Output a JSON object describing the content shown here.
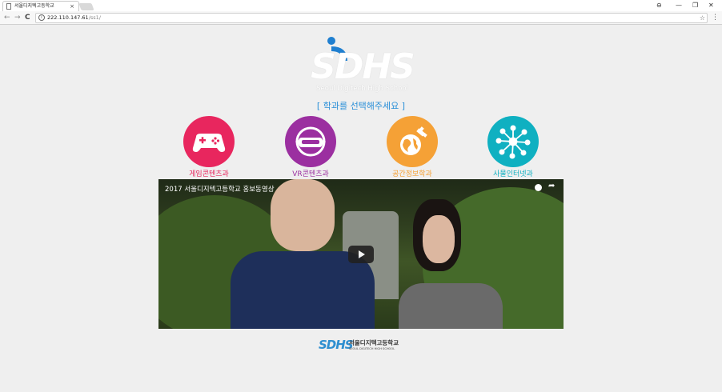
{
  "browser": {
    "tab_title": "서울디지텍고등학교",
    "tab_close": "×",
    "url_host": "222.110.147.61",
    "url_path": "/ss1/",
    "back": "←",
    "forward": "→",
    "reload": "C",
    "info": "i",
    "star": "☆",
    "menu": "⋮",
    "win_account": "⊖",
    "win_minimize": "—",
    "win_restore": "❐",
    "win_close": "✕"
  },
  "logo": {
    "text": "SDHS",
    "subtitle": "Seoul Digitech High School"
  },
  "prompt": "[ 학과를 선택해주세요 ]",
  "departments": [
    {
      "label": "게임콘텐츠과",
      "color": "#e8265e",
      "icon": "gamepad-icon"
    },
    {
      "label": "VR콘텐츠과",
      "color": "#9b2fa0",
      "icon": "vr-headset-icon"
    },
    {
      "label": "공간정보학과",
      "color": "#f5a136",
      "icon": "globe-satellite-icon"
    },
    {
      "label": "사물인터넷과",
      "color": "#0fb0c1",
      "icon": "network-hub-icon"
    }
  ],
  "video": {
    "title": "2017 서울디지텍고등학교 홍보동영상",
    "share": "➦"
  },
  "footer": {
    "logo_text": "SDHS",
    "name_ko": "서울디지텍고등학교",
    "name_en": "SEOUL DIGITECH HIGH SCHOOL"
  }
}
